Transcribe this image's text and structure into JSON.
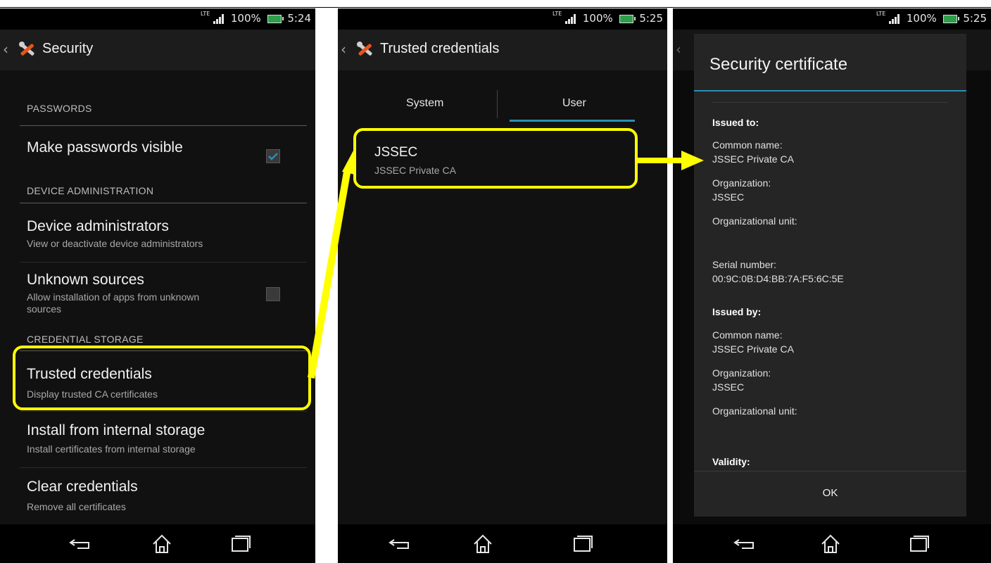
{
  "screens": [
    {
      "status": {
        "lte": "LTE",
        "battery": "100%",
        "time": "5:24"
      },
      "title": "Security",
      "sections": {
        "passwords": "PASSWORDS",
        "device_admin": "DEVICE ADMINISTRATION",
        "credential_storage": "CREDENTIAL STORAGE"
      },
      "items": {
        "make_passwords_visible": {
          "title": "Make passwords visible",
          "checked": true
        },
        "device_administrators": {
          "title": "Device administrators",
          "subtitle": "View or deactivate device administrators"
        },
        "unknown_sources": {
          "title": "Unknown sources",
          "subtitle_1": "Allow installation of apps from unknown",
          "subtitle_2": "sources",
          "checked": false
        },
        "trusted_credentials": {
          "title": "Trusted credentials",
          "subtitle": "Display trusted CA certificates"
        },
        "install_from_storage": {
          "title": "Install from internal storage",
          "subtitle": "Install certificates from internal storage"
        },
        "clear_credentials": {
          "title": "Clear credentials",
          "subtitle": "Remove all certificates"
        }
      }
    },
    {
      "status": {
        "lte": "LTE",
        "battery": "100%",
        "time": "5:25"
      },
      "title": "Trusted credentials",
      "tabs": {
        "system": "System",
        "user": "User",
        "selected": "User"
      },
      "entries": [
        {
          "title": "JSSEC",
          "subtitle": "JSSEC Private CA"
        }
      ]
    },
    {
      "status": {
        "lte": "LTE",
        "battery": "100%",
        "time": "5:25"
      },
      "dialog": {
        "title": "Security certificate",
        "issued_to": "Issued to:",
        "common_name_label": "Common name:",
        "common_name": "JSSEC Private CA",
        "organization_label": "Organization:",
        "organization": "JSSEC",
        "org_unit_label": "Organizational unit:",
        "serial_label": "Serial number:",
        "serial": "00:9C:0B:D4:BB:7A:F5:6C:5E",
        "issued_by": "Issued by:",
        "by_common_name_label": "Common name:",
        "by_common_name": "JSSEC Private CA",
        "by_organization_label": "Organization:",
        "by_organization": "JSSEC",
        "by_org_unit_label": "Organizational unit:",
        "validity": "Validity:",
        "ok": "OK"
      }
    }
  ],
  "colors": {
    "highlight": "#ffff00",
    "accent": "#2b8fb3",
    "background": "#111111"
  },
  "icons": [
    "back-caret-icon",
    "wrench-icon",
    "signal-icon",
    "battery-icon",
    "back-icon",
    "home-icon",
    "recents-icon",
    "arrow-icon"
  ]
}
